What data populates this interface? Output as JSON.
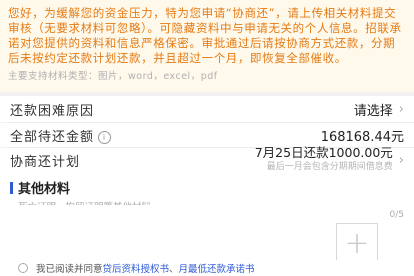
{
  "notice": {
    "text": "您好，为缓解您的资金压力，特为您申请“协商还”，请上传相关材料提交审核（无要求材料可忽略）。可隐藏资料中与申请无关的个人信息。招联承诺对您提供的资料和信息严格保密。审批通过后请按协商方式还款，分期后未按约定还款计划还款，并且超过一个月，即恢复全部催收。",
    "support": "主要支持材料类型：图片，word，excel，pdf"
  },
  "form": {
    "reason_label": "还款困难原因",
    "reason_value": "请选择",
    "amount_label": "全部待还金额",
    "amount_value": "168168.44元",
    "plan_label": "协商还计划",
    "plan_main": "7月25日还款1000.00元",
    "plan_sub": "最后一月会包含分期期间借息费"
  },
  "other_materials": {
    "title": "其他材料",
    "subtitle": "死亡证明、拘留证明等其他材料",
    "counter": "0/5"
  },
  "agreement": {
    "prefix": "我已阅读并同意",
    "doc1": "贷后资料授权书",
    "sep": "、",
    "doc2": "月最低还款承诺书"
  },
  "icons": {
    "info": "info-icon",
    "chevron": "chevron-right-icon",
    "add": "plus-icon"
  },
  "colors": {
    "notice_text": "#e57b14",
    "notice_bg": "#fff9ec",
    "accent": "#2f5bd6"
  }
}
